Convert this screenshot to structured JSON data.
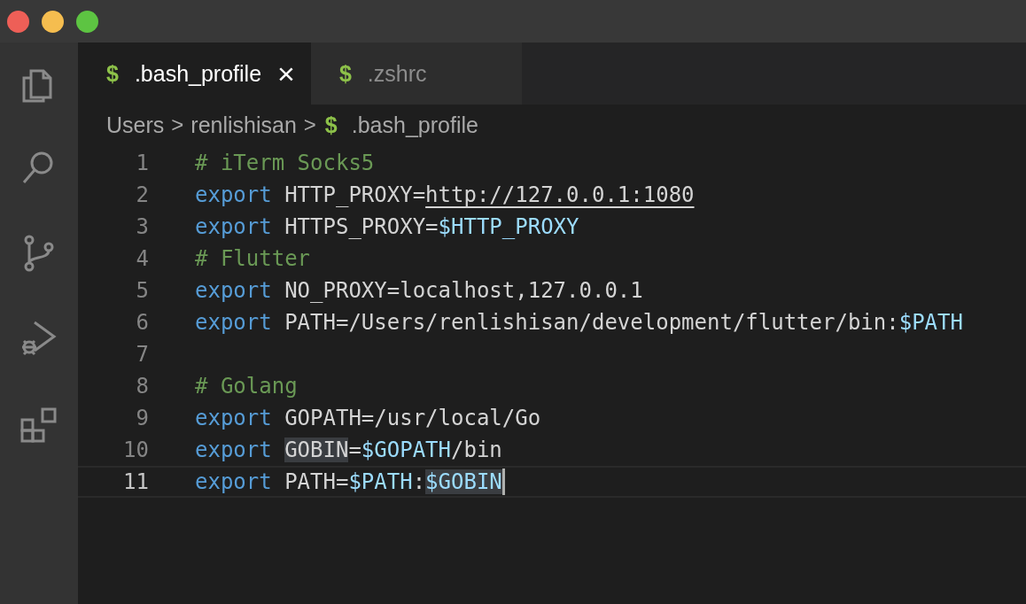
{
  "activity_bar": {
    "items": [
      {
        "kind": "files",
        "selected": false
      },
      {
        "kind": "search",
        "selected": false
      },
      {
        "kind": "source-control",
        "selected": false
      },
      {
        "kind": "run",
        "selected": false
      },
      {
        "kind": "extensions",
        "selected": false
      }
    ]
  },
  "tabs": [
    {
      "icon": "$",
      "label": ".bash_profile",
      "selected": true,
      "close": "×"
    },
    {
      "icon": "$",
      "label": ".zshrc",
      "selected": false
    }
  ],
  "breadcrumb": [
    {
      "label": "Users"
    },
    {
      "label": "renlishisan"
    },
    {
      "label": ".bash_profile",
      "icon": "$"
    }
  ],
  "separator": ">",
  "editor": {
    "lines": [
      {
        "number": "1",
        "current": false,
        "tokens": [
          {
            "kind": "comment",
            "text": "# iTerm Socks5",
            "highlighted": false
          }
        ]
      },
      {
        "number": "2",
        "current": false,
        "tokens": [
          {
            "kind": "keyword",
            "text": "export",
            "highlighted": false
          },
          {
            "kind": "text",
            "text": " HTTP_PROXY=",
            "highlighted": false
          },
          {
            "kind": "link",
            "text": "http://127.0.0.1:1080",
            "highlighted": false
          }
        ]
      },
      {
        "number": "3",
        "current": false,
        "tokens": [
          {
            "kind": "keyword",
            "text": "export",
            "highlighted": false
          },
          {
            "kind": "text",
            "text": " HTTPS_PROXY=",
            "highlighted": false
          },
          {
            "kind": "variable",
            "text": "$HTTP_PROXY",
            "highlighted": false
          }
        ]
      },
      {
        "number": "4",
        "current": false,
        "tokens": [
          {
            "kind": "comment",
            "text": "# Flutter",
            "highlighted": false
          }
        ]
      },
      {
        "number": "5",
        "current": false,
        "tokens": [
          {
            "kind": "keyword",
            "text": "export",
            "highlighted": false
          },
          {
            "kind": "text",
            "text": " NO_PROXY=localhost,127.0.0.1",
            "highlighted": false
          }
        ]
      },
      {
        "number": "6",
        "current": false,
        "tokens": [
          {
            "kind": "keyword",
            "text": "export",
            "highlighted": false
          },
          {
            "kind": "text",
            "text": " PATH=/Users/renlishisan/development/flutter/bin:",
            "highlighted": false
          },
          {
            "kind": "variable",
            "text": "$PATH",
            "highlighted": false
          }
        ]
      },
      {
        "number": "7",
        "current": false
      },
      {
        "number": "8",
        "current": false,
        "tokens": [
          {
            "kind": "comment",
            "text": "# Golang",
            "highlighted": false
          }
        ]
      },
      {
        "number": "9",
        "current": false,
        "tokens": [
          {
            "kind": "keyword",
            "text": "export",
            "highlighted": false
          },
          {
            "kind": "text",
            "text": " GOPATH=/usr/local/Go",
            "highlighted": false
          }
        ]
      },
      {
        "number": "10",
        "current": false,
        "tokens": [
          {
            "kind": "keyword",
            "text": "export ",
            "highlighted": false
          },
          {
            "kind": "text",
            "text": "GOBIN",
            "highlighted": true
          },
          {
            "kind": "text",
            "text": "=",
            "highlighted": false
          },
          {
            "kind": "variable",
            "text": "$GOPATH",
            "highlighted": false
          },
          {
            "kind": "text",
            "text": "/bin",
            "highlighted": false
          }
        ]
      },
      {
        "number": "11",
        "current": true,
        "tokens": [
          {
            "kind": "keyword",
            "text": "export",
            "highlighted": false
          },
          {
            "kind": "text",
            "text": " PATH=",
            "highlighted": false
          },
          {
            "kind": "variable",
            "text": "$PATH",
            "highlighted": false
          },
          {
            "kind": "text",
            "text": ":",
            "highlighted": false
          },
          {
            "kind": "variable",
            "text": "$GOBIN",
            "highlighted": true
          }
        ]
      }
    ]
  }
}
